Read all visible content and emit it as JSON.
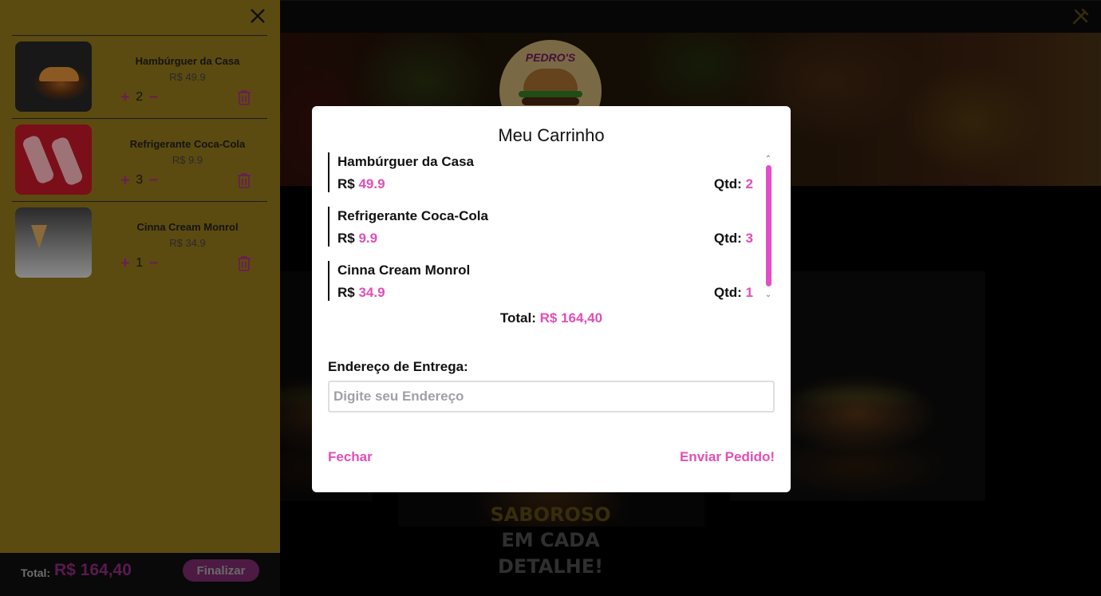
{
  "header": {
    "menu_icon": "utensils-icon"
  },
  "hero": {
    "logo_text": "PEDRO'S"
  },
  "slogan": {
    "line1": "SABOROSO",
    "line2": "EM CADA",
    "line3": "DETALHE!"
  },
  "sidebar": {
    "close_icon": "close-icon",
    "items": [
      {
        "name": "Hambúrguer da Casa",
        "price": "R$ 49.9",
        "qty": "2",
        "image": "burger-photo"
      },
      {
        "name": "Refrigerante Coca-Cola",
        "price": "R$ 9.9",
        "qty": "3",
        "image": "coca-cola-cans-photo"
      },
      {
        "name": "Cinna Cream Monrol",
        "price": "R$ 34.9",
        "qty": "1",
        "image": "cinna-cream-photo"
      }
    ],
    "plus_glyph": "+",
    "minus_glyph": "−",
    "footer": {
      "total_label": "Total:",
      "total_value": "R$ 164,40",
      "finalize_label": "Finalizar"
    }
  },
  "modal": {
    "title": "Meu Carrinho",
    "currency_label": "R$",
    "qty_label": "Qtd:",
    "items": [
      {
        "name": "Hambúrguer da Casa",
        "price": "49.9",
        "qty": "2"
      },
      {
        "name": "Refrigerante Coca-Cola",
        "price": "9.9",
        "qty": "3"
      },
      {
        "name": "Cinna Cream Monrol",
        "price": "34.9",
        "qty": "1"
      }
    ],
    "total_label": "Total:",
    "total_value": "R$ 164,40",
    "address_label": "Endereço de Entrega:",
    "address_placeholder": "Digite seu Endereço",
    "address_value": "",
    "close_label": "Fechar",
    "send_label": "Enviar Pedido!"
  },
  "colors": {
    "accent": "#e14fb5",
    "sidebar_bg": "#5c4b10",
    "modal_bg": "#ffffff"
  }
}
